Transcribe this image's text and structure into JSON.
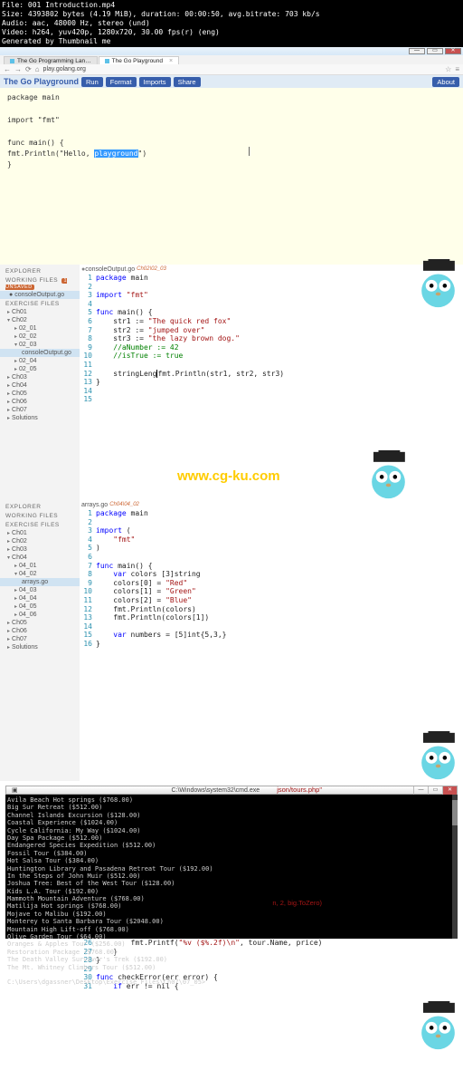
{
  "meta_lines": [
    "File: 001 Introduction.mp4",
    "Size: 4393802 bytes (4.19 MiB), duration: 00:00:50, avg.bitrate: 703 kb/s",
    "Audio: aac, 48000 Hz, stereo (und)",
    "Video: h264, yuv420p, 1280x720, 30.00 fps(r) (eng)",
    "Generated by Thumbnail me"
  ],
  "browser": {
    "tab1": "The Go Programming Lan…",
    "tab2": "The Go Playground",
    "url": "play.golang.org"
  },
  "playground": {
    "title": "The Go Playground",
    "run": "Run",
    "format": "Format",
    "imports": "Imports",
    "share": "Share",
    "about": "About",
    "code_l1": "package main",
    "code_l2": "import \"fmt\"",
    "code_l3a": "func main() {",
    "code_l4a": "        fmt.Println(\"Hello, ",
    "code_l4_sel": "playground",
    "code_l4b": "\")",
    "code_l5": "}"
  },
  "editor1": {
    "explorer": "EXPLORER",
    "working_hdr": "WORKING FILES",
    "unsaved": "1 UNSAVED",
    "working_file": "consoleOutput.go",
    "working_dir": "Ch02\\02_03",
    "exercise_hdr": "EXERCISE FILES",
    "tree": [
      "Ch01",
      "Ch02"
    ],
    "ch02_children": [
      "02_01",
      "02_02",
      "02_03"
    ],
    "sel_file": "consoleOutput.go",
    "tree_after": [
      "02_04",
      "02_05",
      "Ch03",
      "Ch04",
      "Ch05",
      "Ch06",
      "Ch07",
      "Solutions"
    ],
    "tab_file": "consoleOutput.go",
    "tab_status": "Ch02\\02_03",
    "code_lines": [
      "package main",
      "",
      "import \"fmt\"",
      "",
      "func main() {",
      "    str1 := \"The quick red fox\"",
      "    str2 := \"jumped over\"",
      "    str3 := \"the lazy brown dog.\"",
      "    //aNumber := 42",
      "    //isTrue := true",
      "",
      "    stringLengfmt.Println(str1, str2, str3)",
      "}",
      ""
    ]
  },
  "watermark": "www.cg-ku.com",
  "editor2": {
    "tab_file": "arrays.go",
    "tab_status": "Ch04\\04_02",
    "tree": [
      "Ch01",
      "Ch02",
      "Ch03",
      "Ch04"
    ],
    "ch04_children": [
      "04_01",
      "04_02"
    ],
    "sel_file": "arrays.go",
    "tree_after": [
      "04_03",
      "04_04",
      "04_05",
      "04_06",
      "Ch05",
      "Ch06",
      "Ch07",
      "Solutions"
    ],
    "code_lines": [
      "package main",
      "",
      "import (",
      "    \"fmt\"",
      ")",
      "",
      "func main() {",
      "    var colors [3]string",
      "    colors[0] = \"Red\"",
      "    colors[1] = \"Green\"",
      "    colors[2] = \"Blue\"",
      "    fmt.Println(colors)",
      "    fmt.Println(colors[1])",
      "",
      "    var numbers = [5]int{5,3,}",
      "}"
    ]
  },
  "cmd": {
    "title": "C:\\Windows\\system32\\cmd.exe",
    "lines": [
      "Avila Beach Hot springs ($768.00)",
      "Big Sur Retreat ($512.00)",
      "Channel Islands Excursion ($128.00)",
      "Coastal Experience ($1024.00)",
      "Cycle California: My Way ($1024.00)",
      "Day Spa Package ($512.00)",
      "Endangered Species Expedition ($512.00)",
      "Fossil Tour ($384.00)",
      "Hot Salsa Tour ($384.00)",
      "Huntington Library and Pasadena Retreat Tour ($192.00)",
      "In the Steps of John Muir ($512.00)",
      "Joshua Tree: Best of the West Tour ($128.00)",
      "Kids L.A. Tour ($192.00)",
      "Mammoth Mountain Adventure ($768.00)",
      "Matilija Hot springs ($768.00)",
      "Mojave to Malibu ($192.00)",
      "Monterey to Santa Barbara Tour ($2048.00)",
      "Mountain High Lift-off ($768.00)",
      "Olive Garden Tour ($64.00)",
      "Oranges & Apples Tour ($256.00)",
      "Restoration Package ($768.00)",
      "The Death Valley Survivor's Trek ($192.00)",
      "The Mt. Whitney Climbers Tour ($512.00)",
      "",
      "C:\\Users\\dgassner\\Desktop\\Exercise Files\\Ch07\\07_05>"
    ]
  },
  "under": {
    "right_snip": "json/tours.php\"",
    "right_snip2": "n, 2, big.ToZero)",
    "g26": "26",
    "g27": "27",
    "g28": "28",
    "g29": "29",
    "g30": "30",
    "g31": "31",
    "l26": "        fmt.Printf(\"%v ($%.2f)\\n\", tour.Name, price)",
    "l27": "    }",
    "l28": "}",
    "l29": "",
    "l30": "func checkError(err error) {",
    "l31": "    if err != nil {"
  }
}
